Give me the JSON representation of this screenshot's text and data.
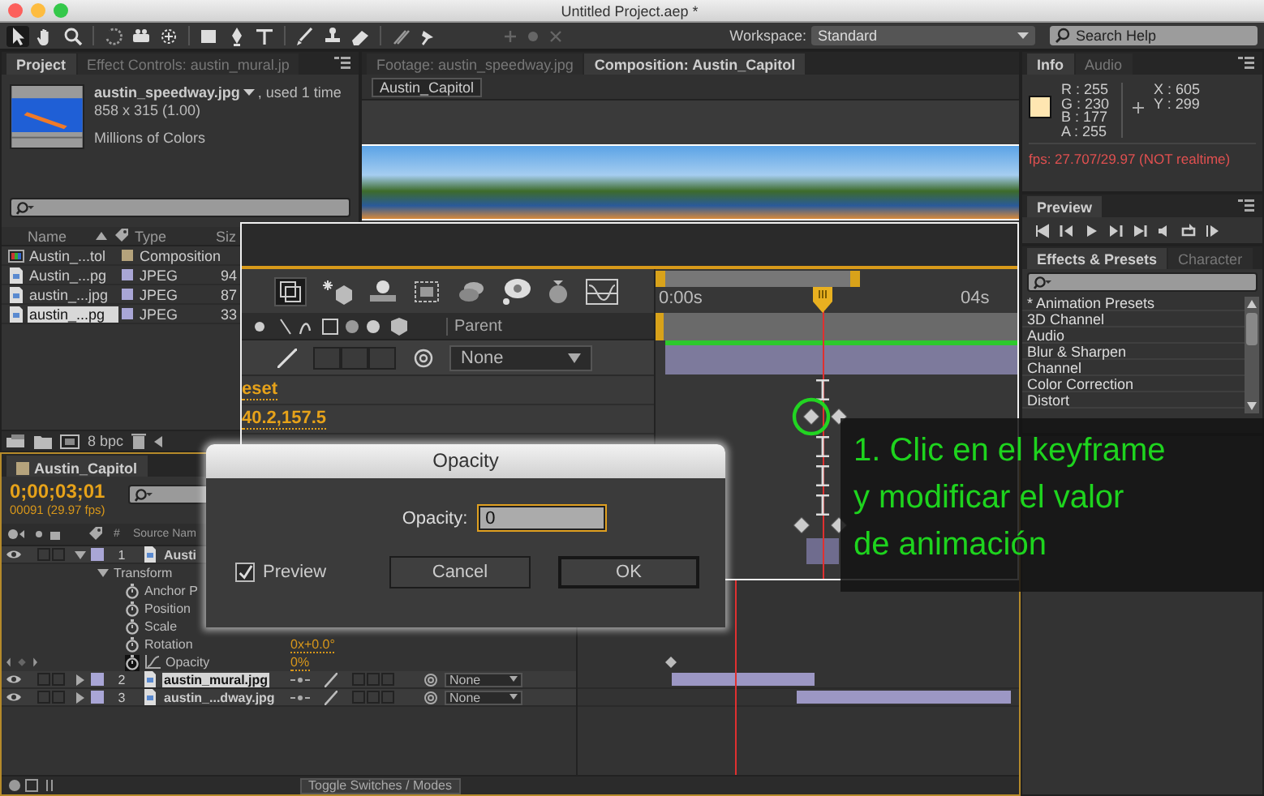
{
  "window": {
    "title": "Untitled Project.aep *"
  },
  "toolbar": {
    "workspace_label": "Workspace:",
    "workspace": "Standard",
    "search": {
      "placeholder": "Search Help"
    }
  },
  "project": {
    "tabs": [
      {
        "label": "Project",
        "selected": true
      },
      {
        "label": "Effect Controls: austin_mural.jp",
        "selected": false
      }
    ],
    "footage": {
      "name": "austin_speedway.jpg",
      "usage": ", used 1 time",
      "dimensions": "858 x 315 (1.00)",
      "colors": "Millions of Colors"
    },
    "columns": [
      "Name",
      "Type",
      "Siz"
    ],
    "items": [
      {
        "kind": "composition",
        "name": "Austin_...tol",
        "type": "Composition",
        "color": "#b5a37c",
        "selected": false
      },
      {
        "kind": "footage",
        "name": "Austin_...pg",
        "type": "JPEG",
        "size": "94",
        "color": "#a9a6d6",
        "selected": false
      },
      {
        "kind": "footage",
        "name": "austin_...jpg",
        "type": "JPEG",
        "size": "87",
        "color": "#a9a6d6",
        "selected": false
      },
      {
        "kind": "footage",
        "name": "austin_...pg",
        "type": "JPEG",
        "size": "33",
        "color": "#a9a6d6",
        "selected": true
      }
    ],
    "bit_depth": "8 bpc"
  },
  "viewer": {
    "tabs": [
      {
        "label": "Footage: austin_speedway.jpg",
        "selected": false
      },
      {
        "label": "Composition: Austin_Capitol",
        "selected": true
      }
    ],
    "comp_tab": "Austin_Capitol"
  },
  "info": {
    "tabs": [
      {
        "label": "Info",
        "selected": true
      },
      {
        "label": "Audio",
        "selected": false
      }
    ],
    "color": "#ffe6b1",
    "channels": [
      "R : 255",
      "G : 230",
      "B : 177",
      "A : 255"
    ],
    "coords": [
      "X : 605",
      "Y : 299"
    ],
    "fps": "fps: 27.707/29.97 (NOT realtime)"
  },
  "preview": {
    "tabs": [
      {
        "label": "Preview",
        "selected": true
      }
    ]
  },
  "effects": {
    "tabs": [
      {
        "label": "Effects & Presets",
        "selected": true
      },
      {
        "label": "Character",
        "selected": false
      }
    ],
    "items": [
      "* Animation Presets",
      "3D Channel",
      "Audio",
      "Blur & Sharpen",
      "Channel",
      "Color Correction",
      "Distort"
    ]
  },
  "timeline": {
    "tab": {
      "label": "Austin_Capitol",
      "selected": true
    },
    "timecode": "0;00;03;01",
    "frame_info": "00091 (29.97 fps)",
    "columns": [
      "#",
      "Source Nam"
    ],
    "layers": [
      {
        "number": "1",
        "name": "Austi",
        "color": "#a9a6d6",
        "expanded": true,
        "selected": false,
        "children": [
          {
            "name": "Transform",
            "expanded": true,
            "children": [
              {
                "name": "Anchor P",
                "keyframed": false
              },
              {
                "name": "Position",
                "keyframed": false
              },
              {
                "name": "Scale",
                "keyframed": false
              },
              {
                "name": "Rotation",
                "value": "0x+0.0°",
                "keyframed": false
              },
              {
                "name": "Opacity",
                "value": "0%",
                "keyframed": true
              }
            ]
          }
        ]
      },
      {
        "number": "2",
        "name": "austin_mural.jpg",
        "color": "#a9a6d6",
        "expanded": false,
        "selected": true,
        "parent": "None"
      },
      {
        "number": "3",
        "name": "austin_...dway.jpg",
        "color": "#a9a6d6",
        "expanded": false,
        "selected": false,
        "parent": "None"
      }
    ],
    "toggle_label": "Toggle Switches / Modes"
  },
  "zoom_inset": {
    "ruler": [
      "0:00s",
      "04s"
    ],
    "parent_label": "Parent",
    "parent": "None",
    "values": [
      "eset",
      "40.2,157.5"
    ]
  },
  "dialog": {
    "title": "Opacity",
    "field_label": "Opacity:",
    "value": "0",
    "preview": {
      "label": "Preview",
      "checked": true
    },
    "buttons": [
      {
        "label": "Cancel",
        "default": false
      },
      {
        "label": "OK",
        "default": true
      }
    ]
  },
  "annotation": {
    "text": "1. Clic en el keyframe\ny modificar el valor\nde animación"
  }
}
